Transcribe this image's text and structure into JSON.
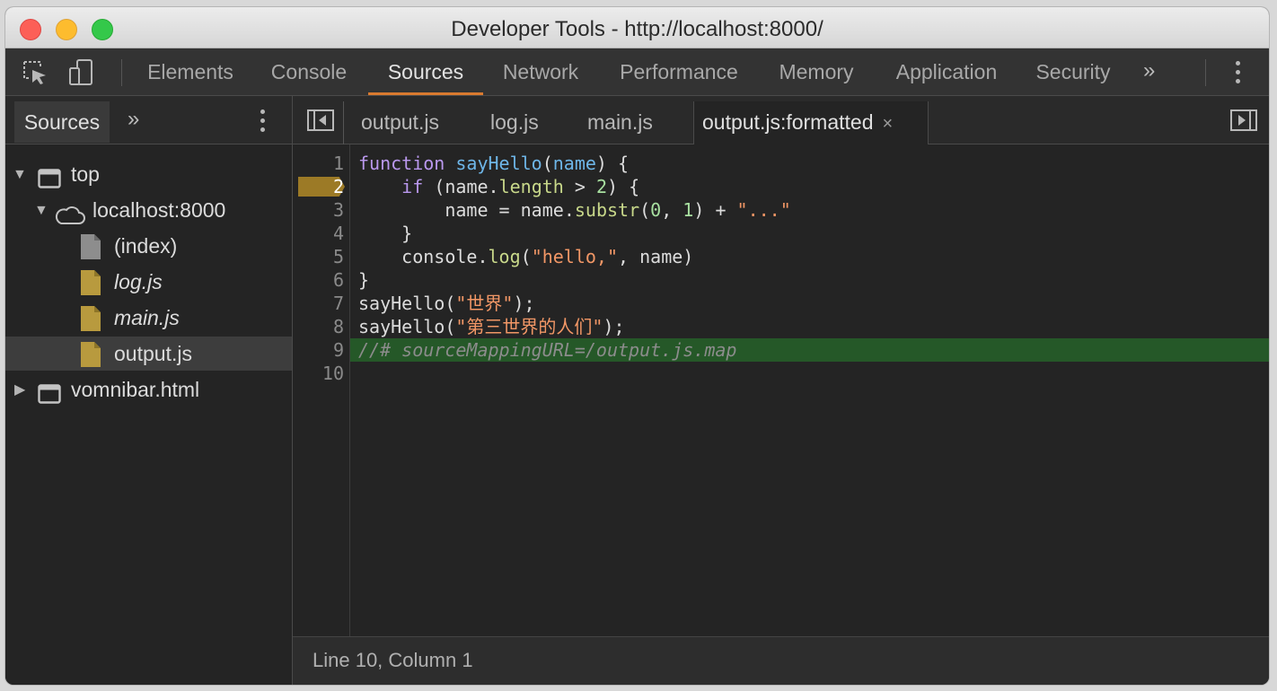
{
  "window": {
    "title": "Developer Tools - http://localhost:8000/"
  },
  "toolbar": {
    "icons": [
      "inspect-element-icon",
      "device-toolbar-icon"
    ],
    "tabs": [
      {
        "label": "Elements",
        "active": false
      },
      {
        "label": "Console",
        "active": false
      },
      {
        "label": "Sources",
        "active": true
      },
      {
        "label": "Network",
        "active": false
      },
      {
        "label": "Performance",
        "active": false
      },
      {
        "label": "Memory",
        "active": false
      },
      {
        "label": "Application",
        "active": false
      },
      {
        "label": "Security",
        "active": false
      }
    ],
    "more_tabs": "»"
  },
  "sidebar": {
    "tab_label": "Sources",
    "more": "»",
    "tree": [
      {
        "label": "top",
        "expanded": true,
        "icon": "frame-icon"
      },
      {
        "label": "localhost:8000",
        "expanded": true,
        "icon": "cloud-icon"
      },
      {
        "label": "(index)",
        "icon": "document-icon"
      },
      {
        "label": "log.js",
        "icon": "script-file-icon",
        "italic": true
      },
      {
        "label": "main.js",
        "icon": "script-file-icon",
        "italic": true
      },
      {
        "label": "output.js",
        "icon": "script-file-icon",
        "selected": true
      },
      {
        "label": "vomnibar.html",
        "expanded": false,
        "icon": "frame-icon"
      }
    ]
  },
  "editor": {
    "tabs": [
      {
        "label": "output.js"
      },
      {
        "label": "log.js"
      },
      {
        "label": "main.js"
      },
      {
        "label": "output.js:formatted",
        "active": true,
        "closable": true
      }
    ],
    "close_glyph": "×",
    "breakpoint_line": 2,
    "highlighted_line": 9,
    "line_numbers": [
      "1",
      "2",
      "3",
      "4",
      "5",
      "6",
      "7",
      "8",
      "9",
      "10"
    ],
    "code": [
      "function sayHello(name) {",
      "    if (name.length > 2) {",
      "        name = name.substr(0, 1) + \"...\"",
      "    }",
      "    console.log(\"hello,\", name)",
      "}",
      "sayHello(\"世界\");",
      "sayHello(\"第三世界的人们\");",
      "//# sourceMappingURL=/output.js.map",
      ""
    ],
    "status": "Line 10, Column 1"
  },
  "colors": {
    "accent": "#d97a2f",
    "breakpoint": "#9c7a26",
    "execution_highlight": "#255828",
    "keyword": "#ba98ee",
    "string": "#f29766"
  }
}
